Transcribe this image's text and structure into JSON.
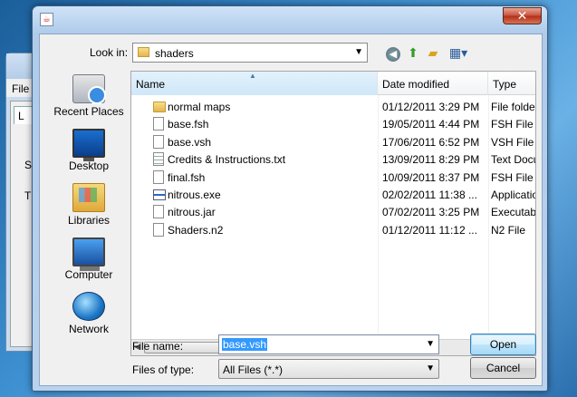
{
  "background_window": {
    "menu_label": "File",
    "tab_label": "L",
    "label_1": "S",
    "label_2": "T"
  },
  "dialog": {
    "title": "",
    "close_glyph": "✕",
    "look_in_label": "Look in:",
    "look_in_value": "shaders",
    "places": [
      {
        "label": "Recent Places",
        "icon": "recent-places-icon"
      },
      {
        "label": "Desktop",
        "icon": "desktop-icon"
      },
      {
        "label": "Libraries",
        "icon": "libraries-icon"
      },
      {
        "label": "Computer",
        "icon": "computer-icon"
      },
      {
        "label": "Network",
        "icon": "network-icon"
      }
    ],
    "columns": {
      "name": "Name",
      "date": "Date modified",
      "type": "Type"
    },
    "files": [
      {
        "name": "normal maps",
        "date": "01/12/2011 3:29 PM",
        "type": "File folder",
        "icon": "folder"
      },
      {
        "name": "base.fsh",
        "date": "19/05/2011 4:44 PM",
        "type": "FSH File",
        "icon": "file"
      },
      {
        "name": "base.vsh",
        "date": "17/06/2011 6:52 PM",
        "type": "VSH File",
        "icon": "file"
      },
      {
        "name": "Credits & Instructions.txt",
        "date": "13/09/2011 8:29 PM",
        "type": "Text Docu",
        "icon": "text"
      },
      {
        "name": "final.fsh",
        "date": "10/09/2011 8:37 PM",
        "type": "FSH File",
        "icon": "file"
      },
      {
        "name": "nitrous.exe",
        "date": "02/02/2011 11:38 ...",
        "type": "Applicatio",
        "icon": "exe"
      },
      {
        "name": "nitrous.jar",
        "date": "07/02/2011 3:25 PM",
        "type": "Executabl",
        "icon": "file"
      },
      {
        "name": "Shaders.n2",
        "date": "01/12/2011 11:12 ...",
        "type": "N2 File",
        "icon": "file"
      }
    ],
    "file_name_label": "File name:",
    "file_name_value": "base.vsh",
    "files_of_type_label": "Files of type:",
    "files_of_type_value": "All Files (*.*)",
    "open_label": "Open",
    "cancel_label": "Cancel"
  }
}
